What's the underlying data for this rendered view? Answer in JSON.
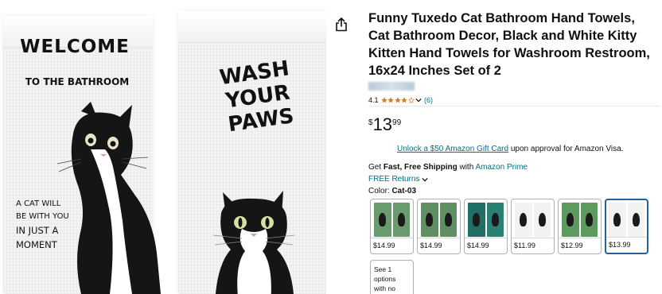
{
  "image": {
    "towel_left": {
      "title": "WELCOME",
      "subtitle": "TO THE BATHROOM",
      "message": [
        "A CAT WILL",
        "BE WITH YOU",
        "IN JUST A",
        "MOMENT"
      ]
    },
    "towel_right": {
      "title": [
        "WASH",
        "YOUR",
        "PAWS"
      ]
    }
  },
  "product": {
    "title": "Funny Tuxedo Cat Bathroom Hand Towels, Cat Bathroom Decor, Black and White Kitty Kitten Hand Towels for Washroom Restroom, 16x24 Inches Set of 2",
    "rating": {
      "value": "4.1",
      "stars": 4,
      "count": "(6)"
    },
    "price": {
      "symbol": "$",
      "whole": "13",
      "fraction": "99"
    },
    "promo": {
      "link": "Unlock a $50 Amazon Gift Card",
      "text": " upon approval for Amazon Visa."
    },
    "shipping": {
      "prefix": "Get ",
      "bold": "Fast, Free Shipping",
      "middle": " with ",
      "prime": "Amazon Prime"
    },
    "returns": "FREE Returns",
    "color": {
      "label": "Color: ",
      "value": "Cat-03"
    },
    "swatches": [
      {
        "price": "$14.99",
        "colors": [
          "#6a9b6e",
          "#6a9b6e"
        ],
        "selected": false
      },
      {
        "price": "$14.99",
        "colors": [
          "#5f8f63",
          "#5f8f63"
        ],
        "selected": false
      },
      {
        "price": "$14.99",
        "colors": [
          "#1f6f66",
          "#2a8075"
        ],
        "selected": false
      },
      {
        "price": "$11.99",
        "colors": [
          "#f2f2f0",
          "#f2f2f0"
        ],
        "selected": false
      },
      {
        "price": "$12.99",
        "colors": [
          "#5c9a5e",
          "#5c9a5e"
        ],
        "selected": false
      },
      {
        "price": "$13.99",
        "colors": [
          "#f2f2f0",
          "#f2f2f0"
        ],
        "selected": true
      }
    ],
    "more_options": [
      "See 1",
      "options",
      "with no"
    ]
  },
  "icons": {
    "share": "share-icon",
    "star": "star-icon",
    "chevron": "chevron-down-icon"
  },
  "colors": {
    "link": "#007185",
    "star": "#de7921",
    "selected_border": "#2162a1"
  }
}
